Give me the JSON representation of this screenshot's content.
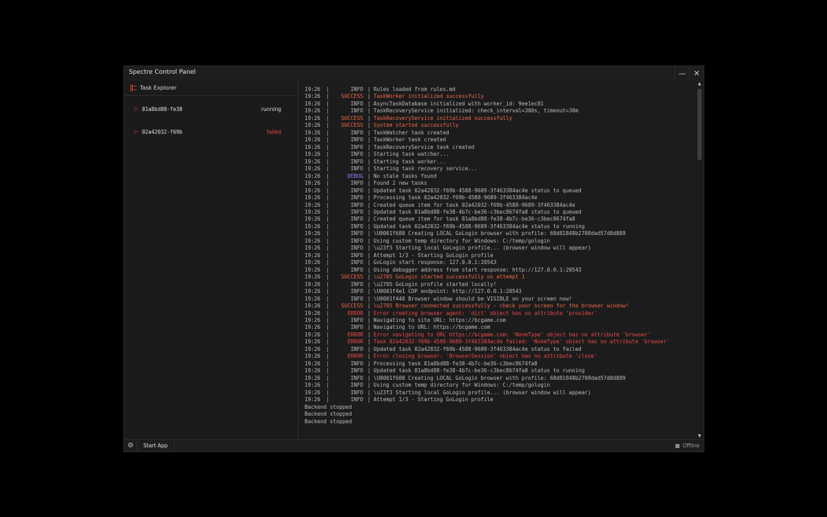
{
  "window": {
    "title": "Spectre Control Panel",
    "minimize": "—",
    "close": "✕"
  },
  "sidebar": {
    "header": "Task Explorer",
    "tasks": [
      {
        "id": "81a8bd88-fe38",
        "status": "running",
        "status_color": "#e0e0e0"
      },
      {
        "id": "02a42032-f69b",
        "status": "failed",
        "status_color": "#ee4a4a"
      }
    ]
  },
  "log": [
    {
      "time": "19:26",
      "level": "INFO",
      "message": "Rules loaded from rules.md"
    },
    {
      "time": "19:26",
      "level": "SUCCESS",
      "message": "TaskWorker initialized successfully"
    },
    {
      "time": "19:26",
      "level": "INFO",
      "message": "AsyncTaskDatabase initialized with worker_id: 9ee1ec81"
    },
    {
      "time": "19:26",
      "level": "INFO",
      "message": "TaskRecoveryService initialized: check_interval=300s, timeout=30m"
    },
    {
      "time": "19:26",
      "level": "SUCCESS",
      "message": "TaskRecoveryService initialized successfully"
    },
    {
      "time": "19:26",
      "level": "SUCCESS",
      "message": "System started successfully"
    },
    {
      "time": "19:26",
      "level": "INFO",
      "message": "TaskWatcher task created"
    },
    {
      "time": "19:26",
      "level": "INFO",
      "message": "TaskWorker task created"
    },
    {
      "time": "19:26",
      "level": "INFO",
      "message": "TaskRecoveryService task created"
    },
    {
      "time": "19:26",
      "level": "INFO",
      "message": "Starting task watcher..."
    },
    {
      "time": "19:26",
      "level": "INFO",
      "message": "Starting task worker..."
    },
    {
      "time": "19:26",
      "level": "INFO",
      "message": "Starting task recovery service..."
    },
    {
      "time": "19:26",
      "level": "DEBUG",
      "message": "No stale tasks found"
    },
    {
      "time": "19:26",
      "level": "INFO",
      "message": "Found 2 new tasks"
    },
    {
      "time": "19:26",
      "level": "INFO",
      "message": "Updated task 02a42032-f69b-4588-9689-3f463384ac4e status to queued"
    },
    {
      "time": "19:26",
      "level": "INFO",
      "message": "Processing task 02a42032-f69b-4588-9689-3f463384ac4e"
    },
    {
      "time": "19:26",
      "level": "INFO",
      "message": "Created queue item for task 02a42032-f69b-4588-9689-3f463384ac4e"
    },
    {
      "time": "19:26",
      "level": "INFO",
      "message": "Updated task 81a8bd88-fe38-4b7c-be36-c3bec8674fa8 status to queued"
    },
    {
      "time": "19:26",
      "level": "INFO",
      "message": "Created queue item for task 81a8bd88-fe38-4b7c-be36-c3bec8674fa8"
    },
    {
      "time": "19:26",
      "level": "INFO",
      "message": "Updated task 02a42032-f69b-4588-9689-3f463384ac4e status to running"
    },
    {
      "time": "19:26",
      "level": "INFO",
      "message": "\\U0001f680 Creating LOCAL GoLogin browser with profile: 68d81848b2708dad57d8d889"
    },
    {
      "time": "19:26",
      "level": "INFO",
      "message": "Using custom temp directory for Windows: C:/temp/gologin"
    },
    {
      "time": "19:26",
      "level": "INFO",
      "message": "\\u23f3 Starting local GoLogin profile... (browser window will appear)"
    },
    {
      "time": "19:26",
      "level": "INFO",
      "message": "Attempt 1/3 - Starting GoLogin profile"
    },
    {
      "time": "19:26",
      "level": "INFO",
      "message": "GoLogin start response: 127.0.0.1:20543"
    },
    {
      "time": "19:26",
      "level": "INFO",
      "message": "Using debugger address from start response: http://127.0.0.1:20543"
    },
    {
      "time": "19:26",
      "level": "SUCCESS",
      "message": "\\u2705 GoLogin started successfully on attempt 1"
    },
    {
      "time": "19:26",
      "level": "INFO",
      "message": "\\u2705 GoLogin profile started locally!"
    },
    {
      "time": "19:26",
      "level": "INFO",
      "message": "\\U0001f4e1 CDP endpoint: http://127.0.0.1:20543"
    },
    {
      "time": "19:26",
      "level": "INFO",
      "message": "\\U0001f440 Browser window should be VISIBLE on your screen now!"
    },
    {
      "time": "19:26",
      "level": "SUCCESS",
      "message": "\\u2705 Browser connected successfully - check your screen for the browser window!"
    },
    {
      "time": "19:26",
      "level": "ERROR",
      "message": "Error creating browser agent: 'dict' object has no attribute 'provider'"
    },
    {
      "time": "19:26",
      "level": "INFO",
      "message": "Navigating to site URL: https://bcgame.com"
    },
    {
      "time": "19:26",
      "level": "INFO",
      "message": "Navigating to URL: https://bcgame.com"
    },
    {
      "time": "19:26",
      "level": "ERROR",
      "message": "Error navigating to URL https://bcgame.com: 'NoneType' object has no attribute 'browser'"
    },
    {
      "time": "19:26",
      "level": "ERROR",
      "message": "Task 02a42032-f69b-4588-9689-3f463384ac4e failed: 'NoneType' object has no attribute 'browser'"
    },
    {
      "time": "19:26",
      "level": "INFO",
      "message": "Updated task 02a42032-f69b-4588-9689-3f463384ac4e status to failed"
    },
    {
      "time": "19:26",
      "level": "ERROR",
      "message": "Error closing browser: 'BrowserSession' object has no attribute 'close'"
    },
    {
      "time": "19:26",
      "level": "INFO",
      "message": "Processing task 81a8bd88-fe38-4b7c-be36-c3bec8674fa8"
    },
    {
      "time": "19:26",
      "level": "INFO",
      "message": "Updated task 81a8bd88-fe38-4b7c-be36-c3bec8674fa8 status to running"
    },
    {
      "time": "19:26",
      "level": "INFO",
      "message": "\\U0001f680 Creating LOCAL GoLogin browser with profile: 68d81848b2708dad57d8d889"
    },
    {
      "time": "19:26",
      "level": "INFO",
      "message": "Using custom temp directory for Windows: C:/temp/gologin"
    },
    {
      "time": "19:26",
      "level": "INFO",
      "message": "\\u23f3 Starting local GoLogin profile... (browser window will appear)"
    },
    {
      "time": "19:26",
      "level": "INFO",
      "message": "Attempt 1/3 - Starting GoLogin profile"
    }
  ],
  "log_plain": [
    "Backend stopped",
    "Backend stopped",
    "Backend stopped"
  ],
  "statusbar": {
    "start_label": "Start App",
    "connection": "Offline"
  },
  "colors": {
    "accent": "#d9442b",
    "error": "#ee4a4a",
    "success": "#ef6a4a",
    "debug": "#8f86ff"
  }
}
